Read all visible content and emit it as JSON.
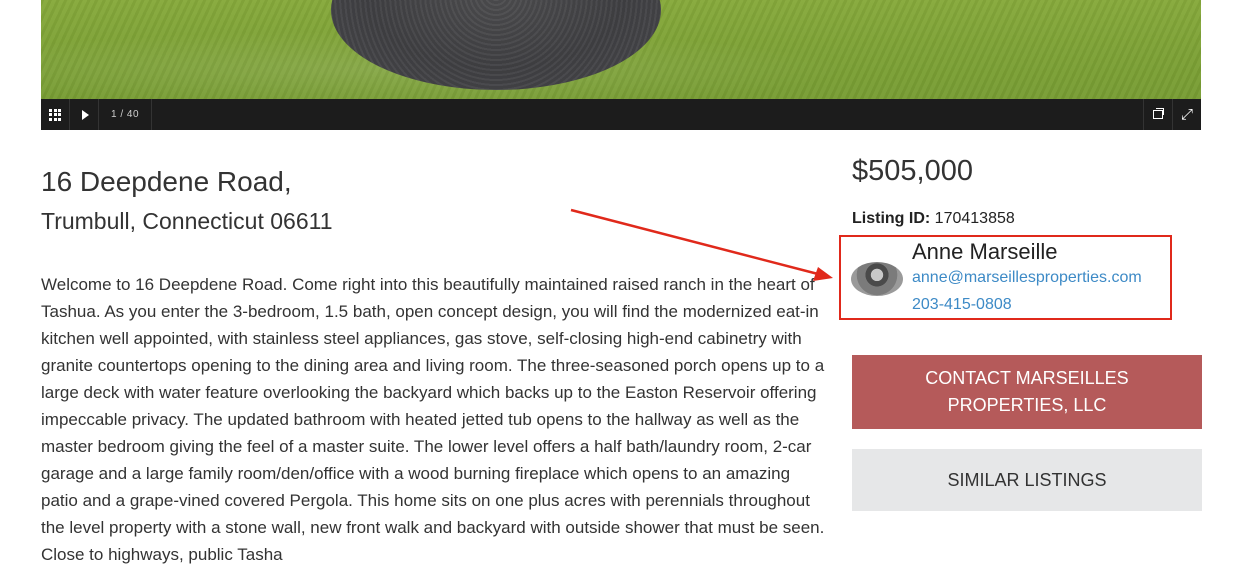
{
  "gallery": {
    "counter": "1 / 40",
    "icons": [
      "grid-icon",
      "play-icon",
      "restore-window-icon",
      "fullscreen-icon"
    ]
  },
  "listing": {
    "address_line1": "16 Deepdene Road,",
    "address_line2": "Trumbull, Connecticut 06611",
    "description": "Welcome to 16 Deepdene Road. Come right into this beautifully maintained raised ranch in the heart of Tashua. As you enter the 3-bedroom, 1.5 bath, open concept design, you will find the modernized eat-in kitchen well appointed, with stainless steel appliances, gas stove, self-closing high-end cabinetry with granite countertops opening to the dining area and living room. The three-seasoned porch opens up to a large deck with water feature overlooking the backyard which backs up to the Easton Reservoir offering impeccable privacy. The updated bathroom with heated jetted tub opens to the hallway as well as the master bedroom giving the feel of a master suite. The lower level offers a half bath/laundry room, 2-car garage and a large family room/den/office with a wood burning fireplace which opens to an amazing patio and a grape-vined covered Pergola. This home sits on one plus acres with perennials throughout the level property with a stone wall, new front walk and backyard with outside shower that must be seen. Close to highways, public Tasha",
    "price": "$505,000",
    "listing_id_label": "Listing ID:",
    "listing_id_value": "170413858"
  },
  "agent": {
    "name": "Anne Marseille",
    "email": "anne@marseillesproperties.com",
    "phone": "203-415-0808"
  },
  "buttons": {
    "contact_label": "CONTACT MARSEILLES PROPERTIES, LLC",
    "similar_label": "SIMILAR LISTINGS"
  },
  "colors": {
    "highlight_red": "#e0291b",
    "contact_button": "#b55a5a",
    "link_blue": "#3d8ac6",
    "similar_button": "#e6e7e8"
  }
}
